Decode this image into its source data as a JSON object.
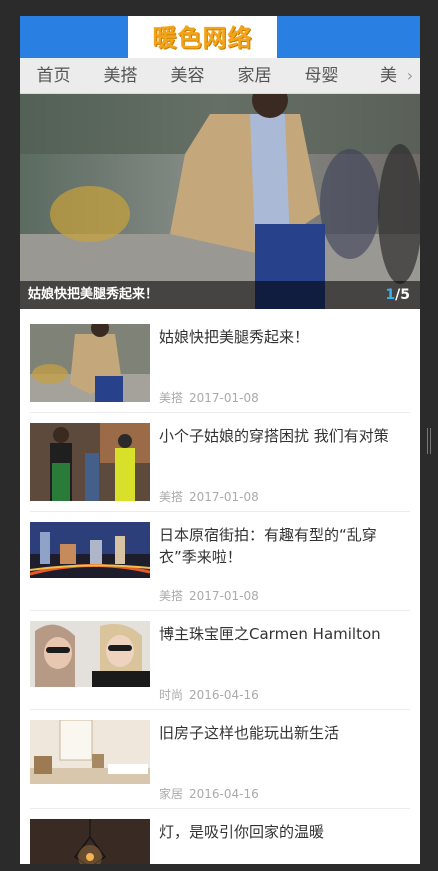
{
  "header": {
    "logo_text": "暖色网络"
  },
  "nav": {
    "items": [
      "首页",
      "美搭",
      "美容",
      "家居",
      "母婴",
      "美"
    ],
    "more_icon": "chevron-right-icon"
  },
  "hero": {
    "title": "姑娘快把美腿秀起来！",
    "current": "1",
    "total": "/5"
  },
  "articles": [
    {
      "title": "姑娘快把美腿秀起来！",
      "category": "美搭",
      "date": "2017-01-08"
    },
    {
      "title": "小个子姑娘的穿搭困扰 我们有对策",
      "category": "美搭",
      "date": "2017-01-08"
    },
    {
      "title": "日本原宿街拍：有趣有型的“乱穿衣”季来啦！",
      "category": "美搭",
      "date": "2017-01-08"
    },
    {
      "title": "博主珠宝匣之Carmen Hamilton",
      "category": "时尚",
      "date": "2016-04-16"
    },
    {
      "title": "旧房子这样也能玩出新生活",
      "category": "家居",
      "date": "2016-04-16"
    },
    {
      "title": "灯，是吸引你回家的温暖",
      "category": "",
      "date": ""
    }
  ],
  "colors": {
    "header_blue": "#2a7fe2",
    "logo_orange": "#f2a51b",
    "pager_active": "#36b3f0"
  }
}
